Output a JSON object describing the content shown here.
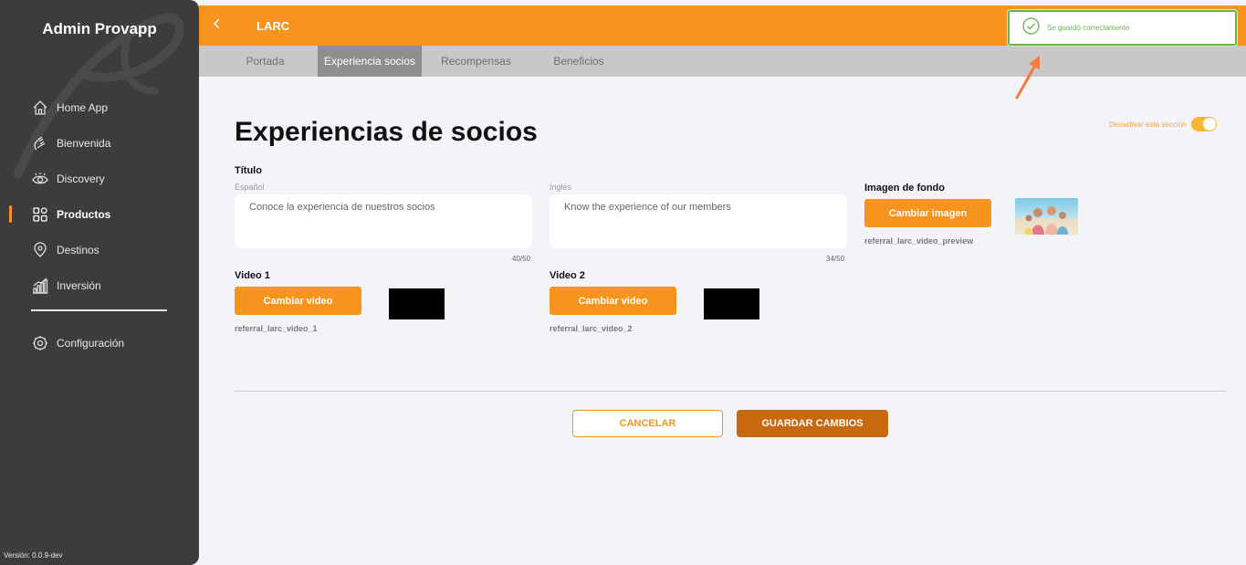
{
  "sidebar": {
    "brand": "Admin Provapp",
    "items": [
      {
        "label": "Home App",
        "icon": "home-icon"
      },
      {
        "label": "Bienvenida",
        "icon": "hand-wave-icon"
      },
      {
        "label": "Discovery",
        "icon": "eye-icon"
      },
      {
        "label": "Productos",
        "icon": "grid-icon",
        "active": true
      },
      {
        "label": "Destinos",
        "icon": "location-pin-icon"
      },
      {
        "label": "Inversión",
        "icon": "bar-chart-icon"
      }
    ],
    "config": {
      "label": "Configuración",
      "icon": "gear-icon"
    },
    "version": "Versión: 0.0.9-dev"
  },
  "topbar": {
    "back_icon": "chevron-left-icon",
    "title": "LARC"
  },
  "tabs": [
    {
      "label": "Portada"
    },
    {
      "label": "Experiencia socios",
      "active": true
    },
    {
      "label": "Recompensas"
    },
    {
      "label": "Beneficios"
    }
  ],
  "toast": {
    "message": "Se guardó correctamente",
    "icon": "check-circle-icon"
  },
  "section_toggle": {
    "label": "Desactivar esta sección",
    "state": "on"
  },
  "main": {
    "title": "Experiencias de socios",
    "titulo_label": "Título",
    "spanish": {
      "label": "Español",
      "value": "Conoce la experiencia de nuestros socios",
      "counter": "40/50"
    },
    "english": {
      "label": "Inglés",
      "value": "Know the experience of our members",
      "counter": "34/50"
    },
    "video1": {
      "label": "Video 1",
      "button": "Cambiar video",
      "filename": "referral_larc_video_1"
    },
    "video2": {
      "label": "Video 2",
      "button": "Cambiar video",
      "filename": "referral_larc_video_2"
    },
    "background": {
      "label": "Imagen de fondo",
      "button": "Cambiar imagen",
      "filename": "referral_larc_video_preview"
    },
    "cancel_label": "CANCELAR",
    "save_label": "GUARDAR CAMBIOS"
  },
  "colors": {
    "accent": "#f7941d",
    "sidebar": "#3c3c3c",
    "success": "#6ab04c",
    "save": "#c9690e"
  }
}
